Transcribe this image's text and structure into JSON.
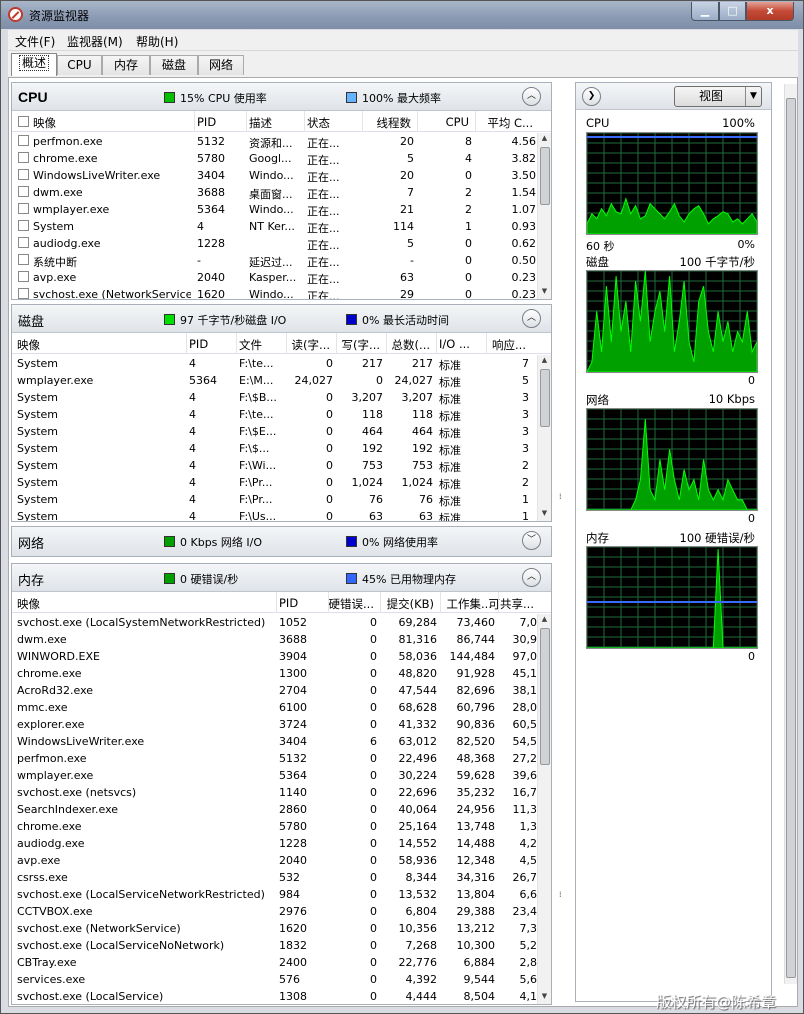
{
  "window": {
    "title": "资源监视器",
    "min_glyph": "▁",
    "max_glyph": "□",
    "close_glyph": "x"
  },
  "menu": [
    {
      "label": "文件(F)"
    },
    {
      "label": "监视器(M)"
    },
    {
      "label": "帮助(H)"
    }
  ],
  "tabs": [
    {
      "label": "概述",
      "active": true
    },
    {
      "label": "CPU"
    },
    {
      "label": "内存"
    },
    {
      "label": "磁盘"
    },
    {
      "label": "网络"
    }
  ],
  "cpu": {
    "title": "CPU",
    "indicator1": {
      "text": "15% CPU 使用率",
      "color": "#00c000"
    },
    "indicator2": {
      "text": "100% 最大频率",
      "color": "#66b3ff"
    },
    "columns": [
      "映像",
      "PID",
      "描述",
      "状态",
      "线程数",
      "CPU",
      "平均 C..."
    ],
    "rows": [
      [
        "perfmon.exe",
        "5132",
        "资源和...",
        "正在...",
        "20",
        "8",
        "4.56"
      ],
      [
        "chrome.exe",
        "5780",
        "Googl...",
        "正在...",
        "5",
        "4",
        "3.82"
      ],
      [
        "WindowsLiveWriter.exe",
        "3404",
        "Windo...",
        "正在...",
        "20",
        "0",
        "3.50"
      ],
      [
        "dwm.exe",
        "3688",
        "桌面窗...",
        "正在...",
        "7",
        "2",
        "1.54"
      ],
      [
        "wmplayer.exe",
        "5364",
        "Windo...",
        "正在...",
        "21",
        "2",
        "1.07"
      ],
      [
        "System",
        "4",
        "NT Ker...",
        "正在...",
        "114",
        "1",
        "0.93"
      ],
      [
        "audiodg.exe",
        "1228",
        "",
        "正在...",
        "5",
        "0",
        "0.62"
      ],
      [
        "系统中断",
        "-",
        "延迟过...",
        "正在...",
        "-",
        "0",
        "0.50"
      ],
      [
        "avp.exe",
        "2040",
        "Kasper...",
        "正在...",
        "63",
        "0",
        "0.23"
      ],
      [
        "svchost.exe (NetworkService)",
        "1620",
        "Windo...",
        "正在...",
        "29",
        "0",
        "0.23"
      ]
    ]
  },
  "disk": {
    "title": "磁盘",
    "indicator1": {
      "text": "97 千字节/秒磁盘 I/O",
      "color": "#00e000"
    },
    "indicator2": {
      "text": "0% 最长活动时间",
      "color": "#0000cc"
    },
    "columns": [
      "映像",
      "PID",
      "文件",
      "读(字...",
      "写(字...",
      "总数(...",
      "I/O ...",
      "响应..."
    ],
    "rows": [
      [
        "System",
        "4",
        "F:\\te...",
        "0",
        "217",
        "217",
        "标准",
        "7"
      ],
      [
        "wmplayer.exe",
        "5364",
        "E:\\M...",
        "24,027",
        "0",
        "24,027",
        "标准",
        "5"
      ],
      [
        "System",
        "4",
        "F:\\$B...",
        "0",
        "3,207",
        "3,207",
        "标准",
        "3"
      ],
      [
        "System",
        "4",
        "F:\\te...",
        "0",
        "118",
        "118",
        "标准",
        "3"
      ],
      [
        "System",
        "4",
        "F:\\$E...",
        "0",
        "464",
        "464",
        "标准",
        "3"
      ],
      [
        "System",
        "4",
        "F:\\$...",
        "0",
        "192",
        "192",
        "标准",
        "3"
      ],
      [
        "System",
        "4",
        "F:\\Wi...",
        "0",
        "753",
        "753",
        "标准",
        "2"
      ],
      [
        "System",
        "4",
        "F:\\Pr...",
        "0",
        "1,024",
        "1,024",
        "标准",
        "2"
      ],
      [
        "System",
        "4",
        "F:\\Pr...",
        "0",
        "76",
        "76",
        "标准",
        "1"
      ],
      [
        "System",
        "4",
        "F:\\Us...",
        "0",
        "63",
        "63",
        "标准",
        "1"
      ]
    ]
  },
  "network": {
    "title": "网络",
    "indicator1": {
      "text": "0 Kbps 网络 I/O",
      "color": "#00a000"
    },
    "indicator2": {
      "text": "0% 网络使用率",
      "color": "#0000cc"
    }
  },
  "memory": {
    "title": "内存",
    "indicator1": {
      "text": "0 硬错误/秒",
      "color": "#00a000"
    },
    "indicator2": {
      "text": "45% 已用物理内存",
      "color": "#3366ff"
    },
    "columns": [
      "映像",
      "PID",
      "硬错误...",
      "提交(KB)",
      "工作集...",
      "可共享..."
    ],
    "rows": [
      [
        "svchost.exe (LocalSystemNetworkRestricted)",
        "1052",
        "0",
        "69,284",
        "73,460",
        "7,0"
      ],
      [
        "dwm.exe",
        "3688",
        "0",
        "81,316",
        "86,744",
        "30,9"
      ],
      [
        "WINWORD.EXE",
        "3904",
        "0",
        "58,036",
        "144,484",
        "97,0"
      ],
      [
        "chrome.exe",
        "1300",
        "0",
        "48,820",
        "91,928",
        "45,1"
      ],
      [
        "AcroRd32.exe",
        "2704",
        "0",
        "47,544",
        "82,696",
        "38,1"
      ],
      [
        "mmc.exe",
        "6100",
        "0",
        "68,628",
        "60,796",
        "28,0"
      ],
      [
        "explorer.exe",
        "3724",
        "0",
        "41,332",
        "90,836",
        "60,5"
      ],
      [
        "WindowsLiveWriter.exe",
        "3404",
        "6",
        "63,012",
        "82,520",
        "54,5"
      ],
      [
        "perfmon.exe",
        "5132",
        "0",
        "22,496",
        "48,368",
        "27,2"
      ],
      [
        "wmplayer.exe",
        "5364",
        "0",
        "30,224",
        "59,628",
        "39,6"
      ],
      [
        "svchost.exe (netsvcs)",
        "1140",
        "0",
        "22,696",
        "35,232",
        "16,7"
      ],
      [
        "SearchIndexer.exe",
        "2860",
        "0",
        "40,064",
        "24,956",
        "11,3"
      ],
      [
        "chrome.exe",
        "5780",
        "0",
        "25,164",
        "13,748",
        "1,3"
      ],
      [
        "audiodg.exe",
        "1228",
        "0",
        "14,552",
        "14,488",
        "4,2"
      ],
      [
        "avp.exe",
        "2040",
        "0",
        "58,936",
        "12,348",
        "4,5"
      ],
      [
        "csrss.exe",
        "532",
        "0",
        "8,344",
        "34,316",
        "26,7"
      ],
      [
        "svchost.exe (LocalServiceNetworkRestricted)",
        "984",
        "0",
        "13,532",
        "13,804",
        "6,6"
      ],
      [
        "CCTVBOX.exe",
        "2976",
        "0",
        "6,804",
        "29,388",
        "23,4"
      ],
      [
        "svchost.exe (NetworkService)",
        "1620",
        "0",
        "10,356",
        "13,212",
        "7,3"
      ],
      [
        "svchost.exe (LocalServiceNoNetwork)",
        "1832",
        "0",
        "7,268",
        "10,300",
        "5,2"
      ],
      [
        "CBTray.exe",
        "2400",
        "0",
        "22,776",
        "6,884",
        "2,8"
      ],
      [
        "services.exe",
        "576",
        "0",
        "4,392",
        "9,544",
        "5,6"
      ],
      [
        "svchost.exe (LocalService)",
        "1308",
        "0",
        "4,444",
        "8,504",
        "4,1"
      ]
    ]
  },
  "right": {
    "view_label": "视图",
    "graphs": [
      {
        "name": "CPU",
        "max": "100%",
        "left": "60 秒",
        "min": "0%"
      },
      {
        "name": "磁盘",
        "max": "100 千字节/秒",
        "min": "0"
      },
      {
        "name": "网络",
        "max": "10 Kbps",
        "min": "0"
      },
      {
        "name": "内存",
        "max": "100 硬错误/秒",
        "min": "0"
      }
    ]
  },
  "watermark": "版权所有@陈希章",
  "colors": {
    "graph_bg": "#000000",
    "graph_grid": "#1f6b3a",
    "graph_line": "#00ff00",
    "graph_fill": "#00a000",
    "graph_blue": "#3a6bff"
  }
}
